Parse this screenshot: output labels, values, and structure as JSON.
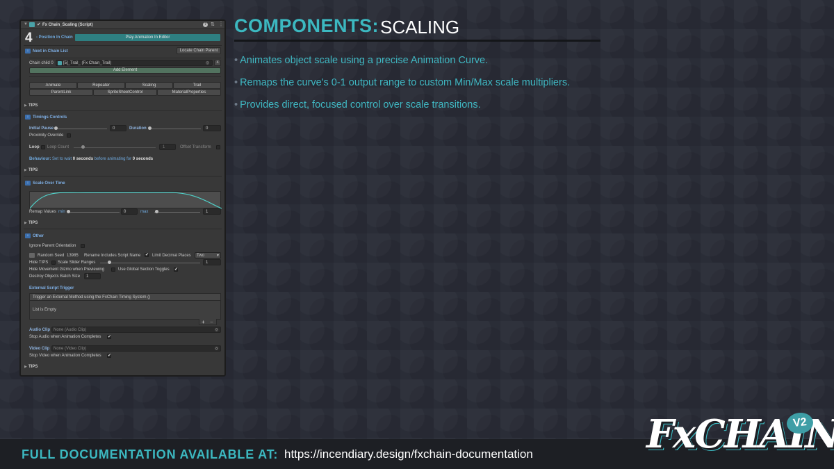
{
  "inspector": {
    "title": "Fx Chain_Scaling (Script)",
    "position_number": "4",
    "position_label": "- Position In Chain",
    "play_button": "Play Animation In Editor",
    "next_header": "Next in Chain List",
    "locate_button": "Locate Chain Parent",
    "chain_child_label": "Chain child 0",
    "chain_child_value": "[5]_Trail_ (Fx Chain_Trail)",
    "remove_label": "X",
    "add_element": "Add Element",
    "component_buttons": [
      [
        "Animate",
        "Repeater",
        "Scaling",
        "Trail"
      ],
      [
        "ParentLink",
        "SpriteSheetControl",
        "MaterialProperties"
      ]
    ],
    "tips_label": "TIPS",
    "timings": {
      "header": "Timings Controls",
      "initial_pause_label": "Initial Pause",
      "initial_pause_value": "0",
      "duration_label": "Duration",
      "duration_value": "0",
      "proximity_override": "Proximity Override",
      "loop_label": "Loop",
      "loop_count_label": "Loop Count",
      "loop_count_value": "1",
      "offset_transform": "Offset Transform",
      "behaviour_label": "Behaviour:",
      "behaviour_text1": "Set to wait",
      "behaviour_val1": "0 seconds",
      "behaviour_text2": "before animating for",
      "behaviour_val2": "0 seconds"
    },
    "scale": {
      "header": "Scale Over Time",
      "remap_label": "Remap Values",
      "min_label": "min",
      "min_value": "0",
      "max_label": "max",
      "max_value": "1"
    },
    "other": {
      "header": "Other",
      "ignore_parent": "Ignore Parent Orientation",
      "random_seed_label": "Random Seed",
      "random_seed_value": "13985",
      "rename_label": "Rename Includes Script Name",
      "limit_decimal_label": "Limit Decimal Places",
      "limit_decimal_value": "Two",
      "hide_tips": "Hide TIPS",
      "scale_slider_ranges": "Scale Slider Ranges",
      "scale_slider_value": "1",
      "hide_gizmo": "Hide Movement Gizmo when Previewing",
      "use_global_toggles": "Use Global Section Toggles",
      "destroy_batch_label": "Destroy Objects Batch Size",
      "destroy_batch_value": "1",
      "external_trigger_header": "External Script Trigger",
      "external_trigger_desc": "Trigger an External Method using the FxChain Timing System ()",
      "list_empty": "List is Empty",
      "plus": "+",
      "minus": "−",
      "audio_label": "Audio Clip",
      "audio_value": "None (Audio Clip)",
      "stop_audio": "Stop Audio when Animation Completes",
      "video_label": "Video Clip",
      "video_value": "None (Video Clip)",
      "stop_video": "Stop Video when Animation Completes"
    },
    "checkmark": "✔"
  },
  "heading": {
    "bold": "COMPONENTS:",
    "light": "SCALING"
  },
  "bullets": [
    "Animates object scale using a precise Animation Curve.",
    "Remaps the curve's 0-1 output range to custom Min/Max scale multipliers.",
    "Provides direct, focused control over scale transitions."
  ],
  "bullet_glyph": "•",
  "footer": {
    "label": "FULL DOCUMENTATION AVAILABLE AT:",
    "url": "https://incendiary.design/fxchain-documentation"
  },
  "logo": {
    "text": "FxCHAIN",
    "badge": "V2"
  },
  "colors": {
    "accent": "#3cb8c0",
    "background": "#2a2d37",
    "footer_bg": "#1d1f24",
    "inspector_bg": "#383838"
  }
}
